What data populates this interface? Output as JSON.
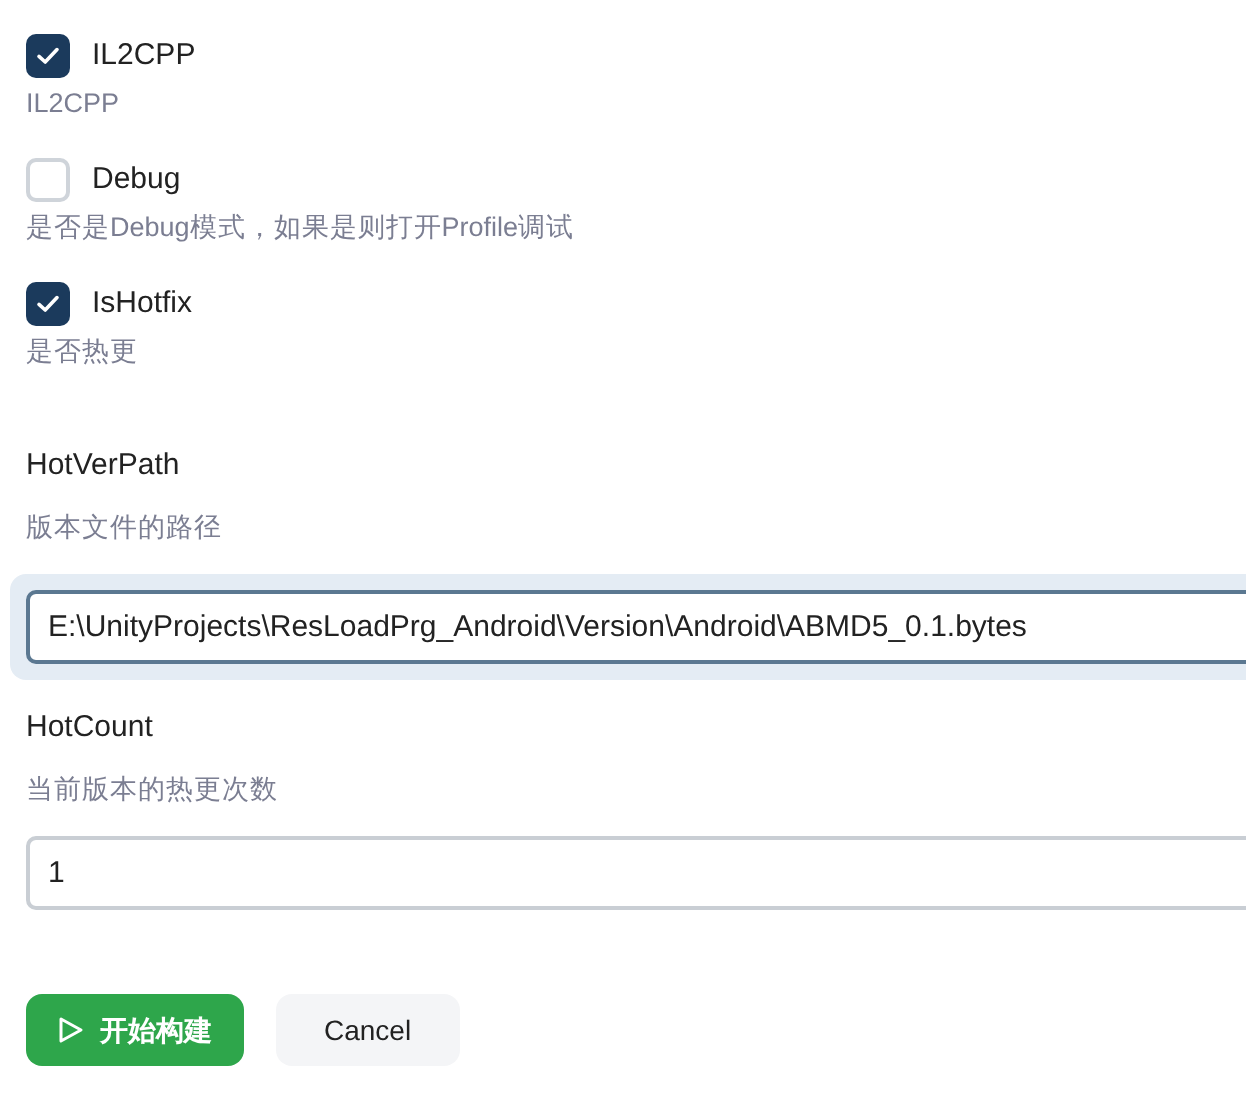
{
  "options": [
    {
      "kind": "checkbox",
      "label": "IL2CPP",
      "checked": true,
      "description": "IL2CPP"
    },
    {
      "kind": "checkbox",
      "label": "Debug",
      "checked": false,
      "description": "是否是Debug模式，如果是则打开Profile调试"
    },
    {
      "kind": "checkbox",
      "label": "IsHotfix",
      "checked": true,
      "description": "是否热更"
    },
    {
      "kind": "text",
      "label": "HotVerPath",
      "description": "版本文件的路径",
      "value": "E:\\UnityProjects\\ResLoadPrg_Android\\Version\\Android\\ABMD5_0.1.bytes",
      "focused": true
    },
    {
      "kind": "text",
      "label": "HotCount",
      "description": "当前版本的热更次数",
      "value": "1",
      "focused": false
    }
  ],
  "buttons": {
    "primary": "开始构建",
    "secondary": "Cancel"
  }
}
